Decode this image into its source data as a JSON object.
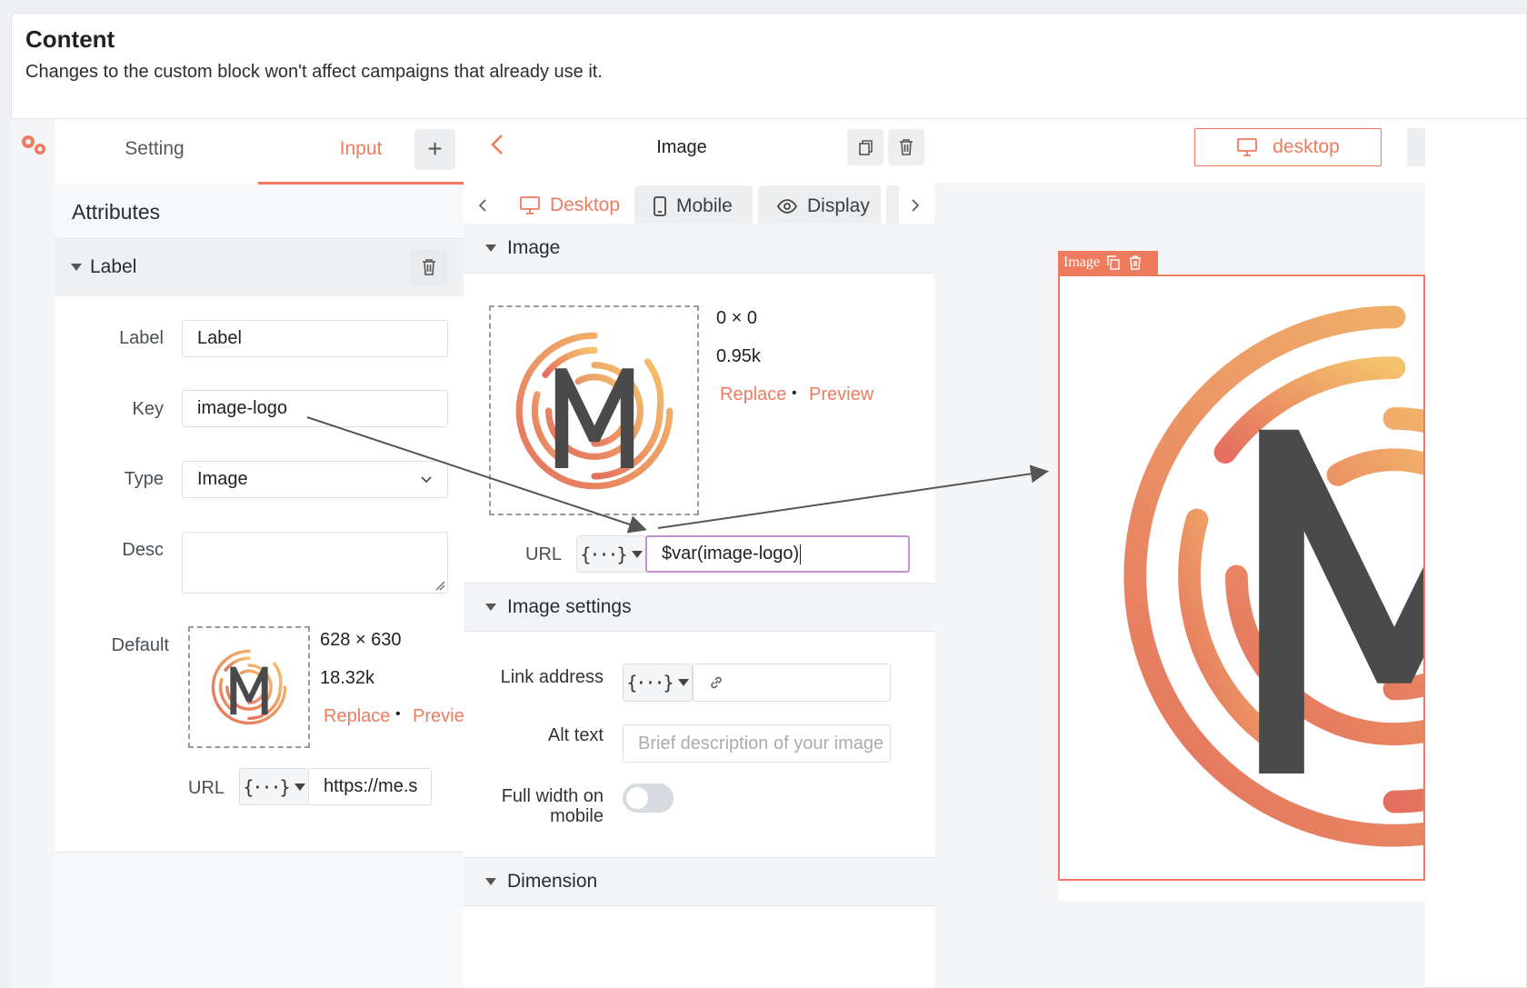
{
  "header": {
    "title": "Content",
    "subtitle": "Changes to the custom block won't affect campaigns that already use it."
  },
  "left_panel": {
    "tabs": [
      "Setting",
      "Input"
    ],
    "active_tab": "Input",
    "attributes_title": "Attributes",
    "group_label": "Label",
    "fields": {
      "label": {
        "label": "Label",
        "value": "Label"
      },
      "key": {
        "label": "Key",
        "value": "image-logo"
      },
      "type": {
        "label": "Type",
        "value": "Image"
      },
      "desc": {
        "label": "Desc",
        "value": ""
      },
      "default": {
        "label": "Default",
        "dimensions": "628 × 630",
        "size": "18.32k",
        "replace": "Replace",
        "separator": "•",
        "preview": "Preview",
        "url_label": "URL",
        "url_value": "https://me.s"
      }
    }
  },
  "middle_panel": {
    "title": "Image",
    "tabs": [
      "Desktop",
      "Mobile",
      "Display"
    ],
    "active_tab": "Desktop",
    "image_section": {
      "title": "Image",
      "dimensions": "0 × 0",
      "size": "0.95k",
      "replace": "Replace",
      "separator": "•",
      "preview": "Preview",
      "url_label": "URL",
      "url_value": "$var(image-logo)"
    },
    "image_settings": {
      "title": "Image settings",
      "link_label": "Link address",
      "link_value": "",
      "alt_label": "Alt text",
      "alt_placeholder": "Brief description of your image",
      "fullwidth_label_1": "Full width on",
      "fullwidth_label_2": "mobile",
      "fullwidth_on": false
    },
    "dimension_section": {
      "title": "Dimension"
    }
  },
  "right_panel": {
    "device_button": "desktop",
    "preview_tag": "Image"
  },
  "colors": {
    "accent": "#ef7b5e",
    "logo_gradient_start": "#e8735f",
    "logo_gradient_end": "#f3b96a",
    "logo_letter": "#4a4a4a"
  }
}
